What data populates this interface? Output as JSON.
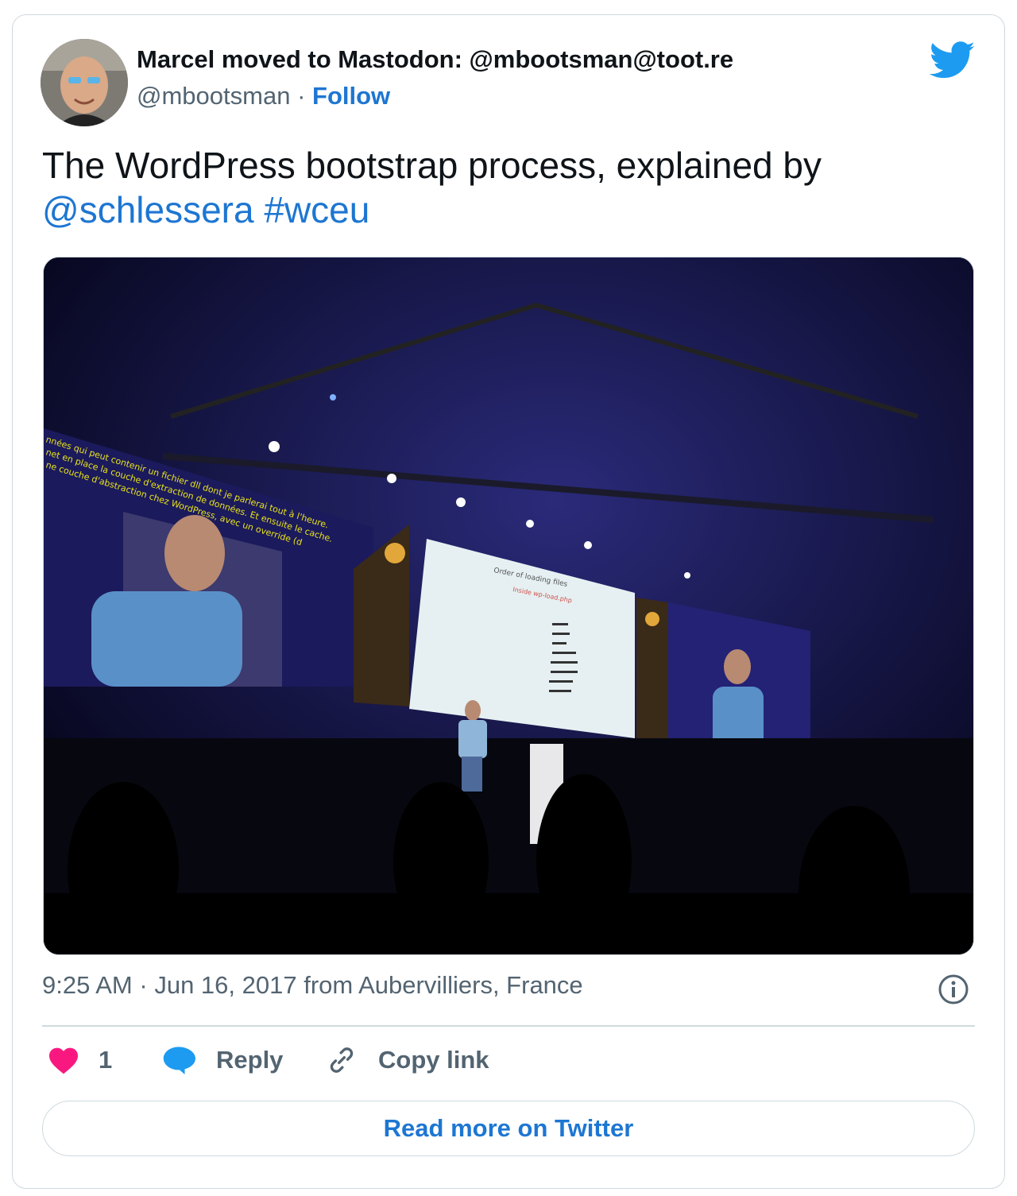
{
  "author": {
    "display_name": "Marcel moved to Mastodon: @mbootsman@toot.re",
    "handle": "@mbootsman",
    "separator": "·",
    "follow_label": "Follow"
  },
  "tweet": {
    "text_main": "The WordPress bootstrap process, explained by",
    "mention": "@schlessera",
    "hashtag": "#wceu"
  },
  "media": {
    "left_screen_caption_lines": [
      "nnées qui peut contenir un fichier dll dont je parlerai tout à l'heure.",
      "net en place la couche d'extraction de données. Et ensuite le cache.",
      "ne couche d'abstraction chez WordPress, avec un override (d"
    ],
    "slide_title": "Order of loading files",
    "slide_subtitle": "Inside wp-load.php"
  },
  "meta": {
    "time": "9:25 AM",
    "separator": "·",
    "date": "Jun 16, 2017",
    "from_text": "from",
    "location": "Aubervilliers, France"
  },
  "actions": {
    "like_count": "1",
    "reply_label": "Reply",
    "copy_link_label": "Copy link"
  },
  "read_more_label": "Read more on Twitter",
  "colors": {
    "link_blue": "#1d76d2",
    "twitter_blue": "#1d9bf0",
    "like_pink": "#f91880",
    "border": "#cfd9de",
    "muted_text": "#536471"
  },
  "icons": [
    "twitter-bird-icon",
    "info-icon",
    "heart-icon",
    "reply-bubble-icon",
    "link-icon"
  ]
}
